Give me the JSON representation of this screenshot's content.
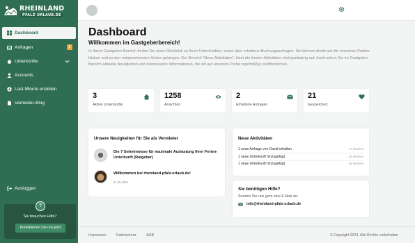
{
  "brand": {
    "line1": "RHEINLAND",
    "line2": "PFALZ-URLAUB.DE",
    "color": "#2f6e53"
  },
  "sidebar": {
    "items": [
      {
        "label": "Dashboard",
        "icon": "dashboard-icon"
      },
      {
        "label": "Anfragen",
        "icon": "inbox-icon",
        "badge": "2"
      },
      {
        "label": "Unterkünfte",
        "icon": "home-icon"
      },
      {
        "label": "Accounts",
        "icon": "user-icon"
      },
      {
        "label": "Last-Minute erstellen",
        "icon": "plus-circle-icon"
      },
      {
        "label": "Vermieter-Blog",
        "icon": "file-icon"
      }
    ],
    "logout": "Ausloggen",
    "help": {
      "icon_text": "?",
      "text": "Sie brauchen Hilfe?",
      "button": "Kontaktieren Sie uns jetzt"
    }
  },
  "header": {
    "user_name": "",
    "user_email": "",
    "settings_icon": "gear-icon"
  },
  "main": {
    "title": "Dashboard",
    "subtitle": "Willkommen im Gastgeberbereich!",
    "intro": "In Ihrem Gastgeber-Bereich finden Sie einen Überblick zu Ihren Unterkünften, sowie über erhaltene Buchungsanfragen. Sie können direkt auf die einzelnen Punkte klicken und zu den entsprechenden Seiten gelangen. Der Bereich \"Neue Aktivitäten\", listet die letzten Aktivitäten stichpunktartig auf. Auch sehen Sie im Gastgeber-Bereich aktuelle Neuigkeiten und interessante Informationen, die wir auf unserem Portal regelmäßig veröffentlichen.",
    "stats": [
      {
        "value": "3",
        "label": "Aktive Unterkünfte",
        "icon": "home-icon"
      },
      {
        "value": "1258",
        "label": "Ansichten",
        "icon": "eye-icon"
      },
      {
        "value": "2",
        "label": "Erhaltene Anfragen",
        "icon": "envelope-icon"
      },
      {
        "value": "21",
        "label": "Gespeichert",
        "icon": "heart-icon"
      }
    ],
    "news": {
      "title": "Unsere Neuigkeiten für Sie als Vermieter",
      "items": [
        {
          "title": "Die 7 Geheimnisse für maximale Auslastung Ihrer Ferien-Unterkunft (Ratgeber)",
          "date": ""
        },
        {
          "title": "Willkommen bei rheinland-pfalz-urlaub.de!",
          "date": "21.05.2024"
        }
      ]
    },
    "activities": {
      "title": "Neue Aktivitäten",
      "items": [
        {
          "text": "1 neue Anfrage von David erhalten",
          "when": "27 Wochen"
        },
        {
          "text": "1 neue Unterkunft hinzugefügt",
          "when": "46 Wochen"
        },
        {
          "text": "1 neue Unterkunft hinzugefügt",
          "when": "46 Wochen"
        }
      ]
    },
    "help": {
      "title": "Sie benötigen Hilfe?",
      "text": "Senden Sie uns gern eine E-Mail an:",
      "email": "info@rheinland-pfalz-urlaub.de"
    }
  },
  "footer": {
    "links": [
      "Impressum",
      "Datenschutz",
      "AGB"
    ],
    "copyright": "© Copyright 2024, Alle Rechte vorbehalten"
  }
}
